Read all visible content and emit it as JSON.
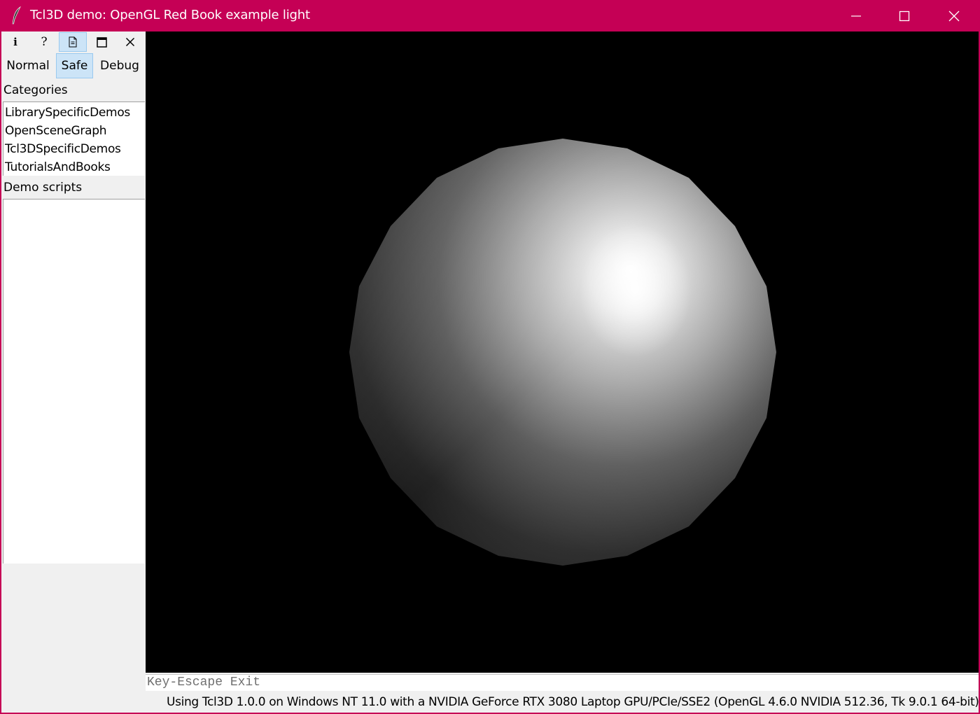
{
  "window": {
    "title": "Tcl3D demo: OpenGL Red Book example light",
    "app_icon": "feather-icon",
    "controls": [
      "minimize-icon",
      "maximize-icon",
      "close-icon"
    ]
  },
  "toolbar": {
    "info_glyph": "i",
    "help_glyph": "?",
    "icons": [
      "info-icon",
      "help-icon",
      "document-icon",
      "window-icon",
      "close-icon"
    ],
    "active": "document-icon"
  },
  "modes": {
    "normal": "Normal",
    "safe": "Safe",
    "debug": "Debug",
    "selected": "Safe"
  },
  "sidebar": {
    "categories_label": "Categories",
    "categories": [
      "LibrarySpecificDemos",
      "OpenSceneGraph",
      "Tcl3DSpecificDemos",
      "TutorialsAndBooks"
    ],
    "demo_scripts_label": "Demo scripts",
    "demo_scripts": []
  },
  "viewport": {
    "background": "#000000",
    "object": "lit-sphere"
  },
  "bindings_line": "Key-Escape Exit",
  "status_line": "Using Tcl3D 1.0.0 on Windows NT 11.0 with a NVIDIA GeForce RTX 3080 Laptop GPU/PCIe/SSE2 (OpenGL 4.6.0 NVIDIA 512.36, Tk 9.0.1 64-bit)",
  "colors": {
    "titlebar": "#c50055",
    "selected_bg": "#cce4f7",
    "panel_bg": "#f0f0f0"
  }
}
